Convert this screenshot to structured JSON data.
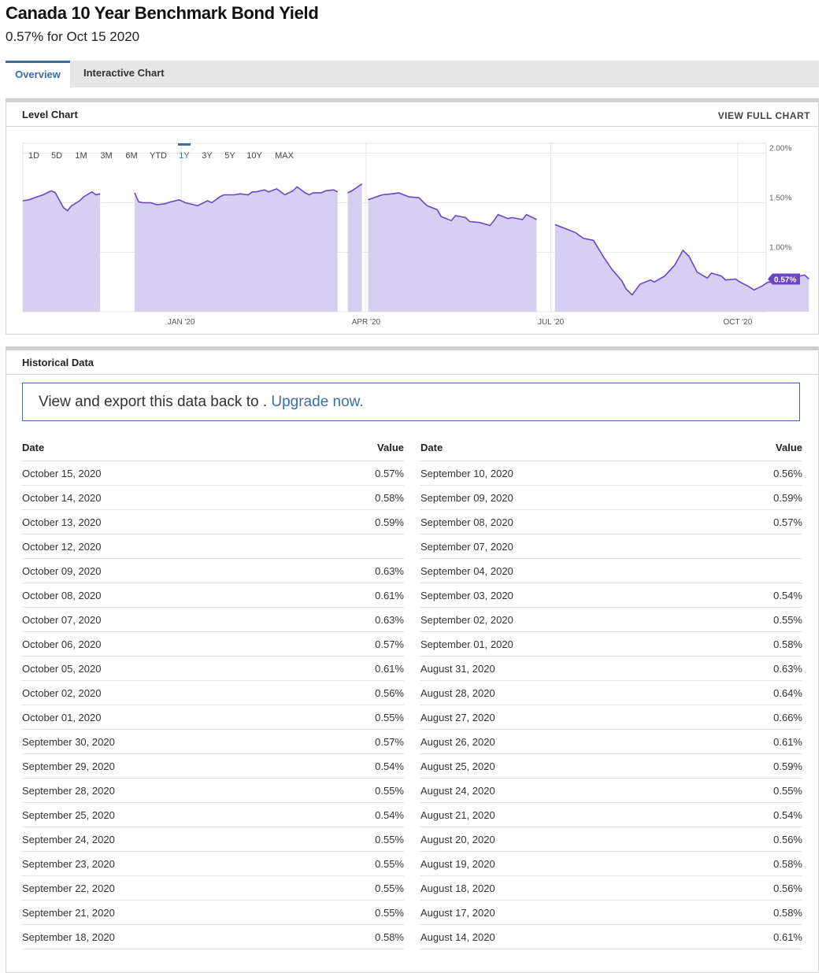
{
  "header": {
    "title": "Canada 10 Year Benchmark Bond Yield",
    "subtitle": "0.57% for Oct 15 2020"
  },
  "tabs": [
    {
      "label": "Overview",
      "active": true
    },
    {
      "label": "Interactive Chart",
      "active": false
    }
  ],
  "level_chart": {
    "panel_title": "Level Chart",
    "view_full_label": "VIEW FULL CHART"
  },
  "colors": {
    "accent": "#3a6ea5",
    "series_line": "#6a45c8",
    "series_fill": "#d7cff2",
    "current_badge": "#6a45c8"
  },
  "chart_data": {
    "type": "area",
    "range_buttons": [
      "1D",
      "5D",
      "1M",
      "3M",
      "6M",
      "YTD",
      "1Y",
      "3Y",
      "5Y",
      "10Y",
      "MAX"
    ],
    "selected_range": "1Y",
    "x_range": [
      "2019-10-15",
      "2020-10-15"
    ],
    "x_ticks": [
      {
        "date": "2020-01-01",
        "label": "JAN '20"
      },
      {
        "date": "2020-04-01",
        "label": "APR '20"
      },
      {
        "date": "2020-07-01",
        "label": "JUL '20"
      },
      {
        "date": "2020-10-01",
        "label": "OCT '20"
      }
    ],
    "y_ticks": [
      1.0,
      1.5,
      2.0
    ],
    "y_tick_labels": [
      "1.00%",
      "1.50%",
      "2.00%"
    ],
    "ylim": [
      0.4,
      2.1
    ],
    "current_value_label": "0.57%",
    "series": [
      {
        "segments": [
          [
            [
              "2019-10-15",
              1.52
            ],
            [
              "2019-10-18",
              1.53
            ],
            [
              "2019-10-22",
              1.56
            ],
            [
              "2019-10-25",
              1.58
            ],
            [
              "2019-10-29",
              1.62
            ],
            [
              "2019-10-31",
              1.6
            ],
            [
              "2019-11-04",
              1.45
            ],
            [
              "2019-11-06",
              1.42
            ],
            [
              "2019-11-08",
              1.47
            ],
            [
              "2019-11-12",
              1.52
            ],
            [
              "2019-11-14",
              1.56
            ],
            [
              "2019-11-18",
              1.61
            ],
            [
              "2019-11-20",
              1.58
            ],
            [
              "2019-11-22",
              1.59
            ]
          ],
          [
            [
              "2019-12-09",
              1.6
            ],
            [
              "2019-12-11",
              1.51
            ],
            [
              "2019-12-13",
              1.5
            ],
            [
              "2019-12-17",
              1.5
            ],
            [
              "2019-12-20",
              1.48
            ],
            [
              "2019-12-24",
              1.49
            ],
            [
              "2019-12-27",
              1.51
            ],
            [
              "2019-12-31",
              1.53
            ],
            [
              "2020-01-03",
              1.5
            ],
            [
              "2020-01-07",
              1.48
            ],
            [
              "2020-01-09",
              1.47
            ],
            [
              "2020-01-14",
              1.52
            ],
            [
              "2020-01-16",
              1.5
            ],
            [
              "2020-01-20",
              1.56
            ],
            [
              "2020-01-22",
              1.58
            ],
            [
              "2020-01-27",
              1.58
            ],
            [
              "2020-01-30",
              1.59
            ],
            [
              "2020-02-03",
              1.58
            ],
            [
              "2020-02-05",
              1.61
            ],
            [
              "2020-02-07",
              1.61
            ],
            [
              "2020-02-11",
              1.63
            ],
            [
              "2020-02-13",
              1.61
            ],
            [
              "2020-02-17",
              1.64
            ],
            [
              "2020-02-19",
              1.61
            ],
            [
              "2020-02-21",
              1.58
            ],
            [
              "2020-02-25",
              1.62
            ],
            [
              "2020-02-27",
              1.66
            ],
            [
              "2020-03-02",
              1.6
            ],
            [
              "2020-03-04",
              1.58
            ],
            [
              "2020-03-06",
              1.6
            ],
            [
              "2020-03-10",
              1.6
            ],
            [
              "2020-03-12",
              1.62
            ],
            [
              "2020-03-16",
              1.63
            ],
            [
              "2020-03-18",
              1.61
            ]
          ],
          [
            [
              "2020-03-23",
              1.6
            ],
            [
              "2020-03-25",
              1.62
            ],
            [
              "2020-03-30",
              1.69
            ]
          ],
          [
            [
              "2020-04-02",
              1.53
            ],
            [
              "2020-04-06",
              1.56
            ],
            [
              "2020-04-09",
              1.58
            ],
            [
              "2020-04-14",
              1.59
            ],
            [
              "2020-04-17",
              1.6
            ],
            [
              "2020-04-22",
              1.56
            ],
            [
              "2020-04-27",
              1.55
            ],
            [
              "2020-05-01",
              1.47
            ],
            [
              "2020-05-06",
              1.43
            ],
            [
              "2020-05-08",
              1.36
            ],
            [
              "2020-05-13",
              1.32
            ],
            [
              "2020-05-15",
              1.37
            ],
            [
              "2020-05-20",
              1.35
            ],
            [
              "2020-05-22",
              1.31
            ],
            [
              "2020-05-27",
              1.3
            ],
            [
              "2020-06-01",
              1.27
            ],
            [
              "2020-06-03",
              1.32
            ],
            [
              "2020-06-05",
              1.38
            ],
            [
              "2020-06-10",
              1.34
            ],
            [
              "2020-06-12",
              1.35
            ],
            [
              "2020-06-17",
              1.33
            ],
            [
              "2020-06-19",
              1.38
            ],
            [
              "2020-06-24",
              1.33
            ]
          ],
          [
            [
              "2020-07-03",
              1.28
            ],
            [
              "2020-07-08",
              1.24
            ],
            [
              "2020-07-13",
              1.2
            ],
            [
              "2020-07-17",
              1.14
            ],
            [
              "2020-07-22",
              1.12
            ],
            [
              "2020-07-27",
              0.95
            ],
            [
              "2020-07-31",
              0.83
            ],
            [
              "2020-08-05",
              0.71
            ],
            [
              "2020-08-07",
              0.63
            ],
            [
              "2020-08-10",
              0.57
            ],
            [
              "2020-08-14",
              0.68
            ],
            [
              "2020-08-19",
              0.72
            ],
            [
              "2020-08-21",
              0.7
            ],
            [
              "2020-08-26",
              0.76
            ],
            [
              "2020-08-31",
              0.87
            ],
            [
              "2020-09-04",
              1.02
            ],
            [
              "2020-09-07",
              0.96
            ],
            [
              "2020-09-11",
              0.8
            ],
            [
              "2020-09-16",
              0.74
            ],
            [
              "2020-09-18",
              0.79
            ],
            [
              "2020-09-23",
              0.76
            ],
            [
              "2020-09-25",
              0.72
            ],
            [
              "2020-09-30",
              0.73
            ],
            [
              "2020-10-02",
              0.7
            ],
            [
              "2020-10-06",
              0.66
            ],
            [
              "2020-10-09",
              0.62
            ],
            [
              "2020-10-13",
              0.66
            ],
            [
              "2020-10-16",
              0.7
            ],
            [
              "2020-10-21",
              0.69
            ],
            [
              "2020-10-26",
              0.72
            ],
            [
              "2020-10-29",
              0.75
            ],
            [
              "2020-11-03",
              0.77
            ],
            [
              "2020-11-05",
              0.73
            ]
          ]
        ]
      }
    ]
  },
  "historical": {
    "panel_title": "Historical Data",
    "upsell_text": "View and export this data back to . ",
    "upsell_link": "Upgrade now.",
    "col_date": "Date",
    "col_value": "Value",
    "left_rows": [
      {
        "date": "October 15, 2020",
        "value": "0.57%"
      },
      {
        "date": "October 14, 2020",
        "value": "0.58%"
      },
      {
        "date": "October 13, 2020",
        "value": "0.59%"
      },
      {
        "date": "October 12, 2020",
        "value": ""
      },
      {
        "date": "October 09, 2020",
        "value": "0.63%"
      },
      {
        "date": "October 08, 2020",
        "value": "0.61%"
      },
      {
        "date": "October 07, 2020",
        "value": "0.63%"
      },
      {
        "date": "October 06, 2020",
        "value": "0.57%"
      },
      {
        "date": "October 05, 2020",
        "value": "0.61%"
      },
      {
        "date": "October 02, 2020",
        "value": "0.56%"
      },
      {
        "date": "October 01, 2020",
        "value": "0.55%"
      },
      {
        "date": "September 30, 2020",
        "value": "0.57%"
      },
      {
        "date": "September 29, 2020",
        "value": "0.54%"
      },
      {
        "date": "September 28, 2020",
        "value": "0.55%"
      },
      {
        "date": "September 25, 2020",
        "value": "0.54%"
      },
      {
        "date": "September 24, 2020",
        "value": "0.55%"
      },
      {
        "date": "September 23, 2020",
        "value": "0.55%"
      },
      {
        "date": "September 22, 2020",
        "value": "0.55%"
      },
      {
        "date": "September 21, 2020",
        "value": "0.55%"
      },
      {
        "date": "September 18, 2020",
        "value": "0.58%"
      }
    ],
    "right_rows": [
      {
        "date": "September 10, 2020",
        "value": "0.56%"
      },
      {
        "date": "September 09, 2020",
        "value": "0.59%"
      },
      {
        "date": "September 08, 2020",
        "value": "0.57%"
      },
      {
        "date": "September 07, 2020",
        "value": ""
      },
      {
        "date": "September 04, 2020",
        "value": ""
      },
      {
        "date": "September 03, 2020",
        "value": "0.54%"
      },
      {
        "date": "September 02, 2020",
        "value": "0.55%"
      },
      {
        "date": "September 01, 2020",
        "value": "0.58%"
      },
      {
        "date": "August 31, 2020",
        "value": "0.63%"
      },
      {
        "date": "August 28, 2020",
        "value": "0.64%"
      },
      {
        "date": "August 27, 2020",
        "value": "0.66%"
      },
      {
        "date": "August 26, 2020",
        "value": "0.61%"
      },
      {
        "date": "August 25, 2020",
        "value": "0.59%"
      },
      {
        "date": "August 24, 2020",
        "value": "0.55%"
      },
      {
        "date": "August 21, 2020",
        "value": "0.54%"
      },
      {
        "date": "August 20, 2020",
        "value": "0.56%"
      },
      {
        "date": "August 19, 2020",
        "value": "0.58%"
      },
      {
        "date": "August 18, 2020",
        "value": "0.56%"
      },
      {
        "date": "August 17, 2020",
        "value": "0.58%"
      },
      {
        "date": "August 14, 2020",
        "value": "0.61%"
      }
    ]
  }
}
